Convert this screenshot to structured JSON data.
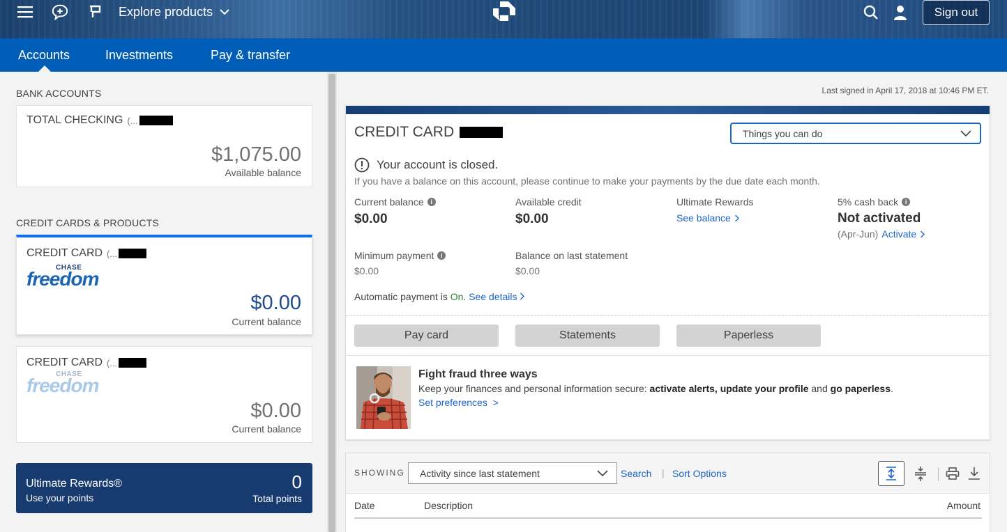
{
  "header": {
    "explore_label": "Explore products",
    "sign_out_label": "Sign out",
    "icons": [
      "menu-icon",
      "chat-icon",
      "flag-icon",
      "chevron-down-icon",
      "chase-logo",
      "search-icon",
      "user-icon"
    ]
  },
  "nav": {
    "tabs": [
      {
        "label": "Accounts",
        "active": true
      },
      {
        "label": "Investments",
        "active": false
      },
      {
        "label": "Pay & transfer",
        "active": false
      }
    ]
  },
  "sidebar": {
    "bank_accounts_heading": "BANK ACCOUNTS",
    "checking": {
      "name": "TOTAL CHECKING",
      "suffix": "(...",
      "amount": "$1,075.00",
      "sub": "Available balance"
    },
    "credit_heading": "CREDIT CARDS & PRODUCTS",
    "cards": [
      {
        "name": "CREDIT CARD",
        "suffix": "(...",
        "brand_top": "CHASE",
        "brand": "freedom",
        "amount": "$0.00",
        "sub": "Current balance",
        "selected": true
      },
      {
        "name": "CREDIT CARD",
        "suffix": "(...",
        "brand_top": "CHASE",
        "brand": "freedom",
        "amount": "$0.00",
        "sub": "Current balance",
        "selected": false
      }
    ],
    "rewards": {
      "title": "Ultimate Rewards®",
      "subtitle": "Use your points",
      "points": "0",
      "points_label": "Total points"
    }
  },
  "main": {
    "last_signed": "Last signed in April 17, 2018 at 10:46 PM ET.",
    "card_title": "CREDIT CARD",
    "things_label": "Things you can do",
    "closed_msg": "Your account is closed.",
    "closed_note": "If you have a balance on this account, please continue to make your payments by the due date each month.",
    "current_balance_label": "Current balance",
    "current_balance": "$0.00",
    "available_credit_label": "Available credit",
    "available_credit": "$0.00",
    "ultimate_rewards_label": "Ultimate Rewards",
    "see_balance": "See balance",
    "cashback_label": "5% cash back",
    "cashback_status": "Not activated",
    "cashback_period": "(Apr-Jun)",
    "activate": "Activate",
    "min_payment_label": "Minimum payment",
    "min_payment": "$0.00",
    "last_statement_label": "Balance on last statement",
    "last_statement": "$0.00",
    "autopay_prefix": "Automatic payment is",
    "autopay_status": "On",
    "autopay_period": ".",
    "see_details": "See details",
    "buttons": {
      "pay": "Pay card",
      "statements": "Statements",
      "paperless": "Paperless"
    },
    "promo": {
      "title": "Fight fraud three ways",
      "text_prefix": "Keep your finances and personal information secure:",
      "text_bold": "activate alerts, update your profile",
      "text_mid": "and",
      "text_bold2": "go paperless",
      "text_end": ".",
      "link": "Set preferences  >"
    }
  },
  "activity": {
    "showing_label": "SHOWING",
    "filter_value": "Activity since last statement",
    "search": "Search",
    "sort": "Sort Options",
    "columns": {
      "date": "Date",
      "description": "Description",
      "amount": "Amount"
    }
  },
  "colors": {
    "nav_blue": "#005eb8",
    "link_blue": "#1a66c7",
    "rewards_navy": "#173a6f",
    "autopay_green": "#2e7d32"
  }
}
